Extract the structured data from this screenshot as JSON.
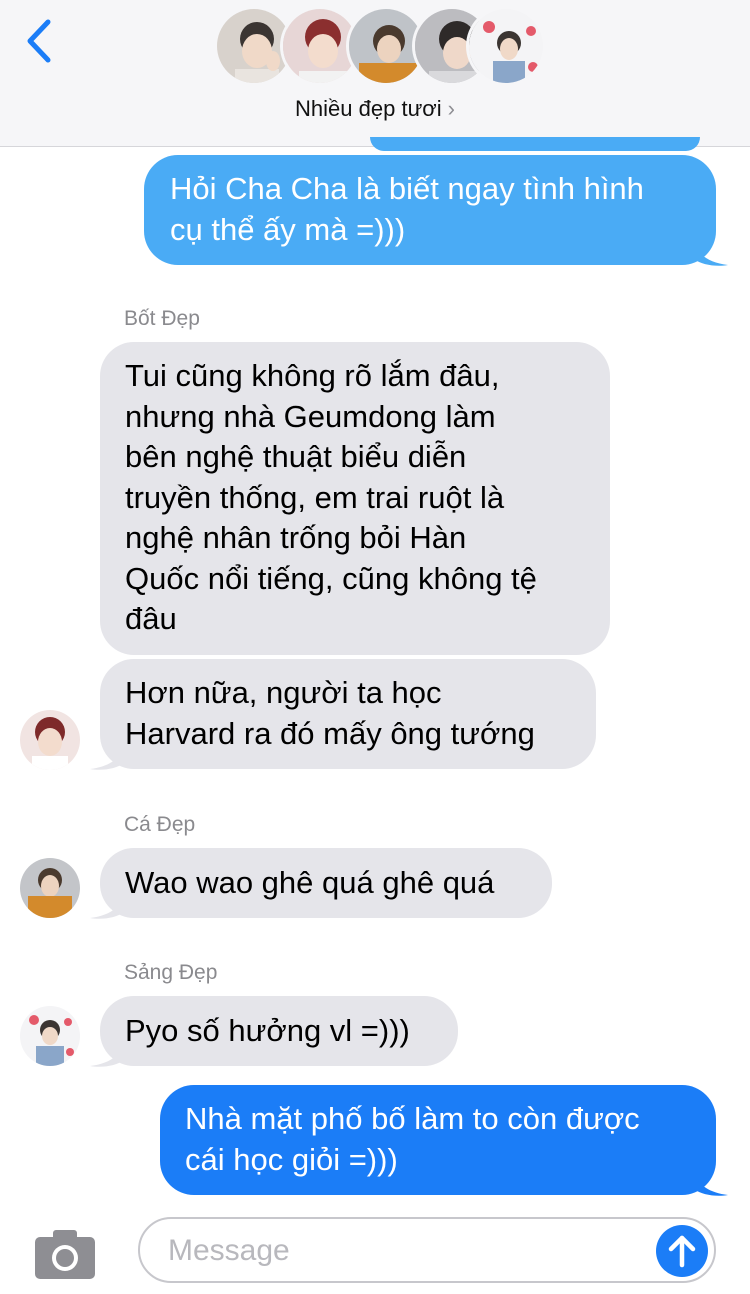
{
  "header": {
    "back_icon": "chevron-left-icon",
    "group_name": "Nhiều đẹp tươi",
    "group_chevron": "›",
    "accent": "#1b7df7"
  },
  "messages": [
    {
      "kind": "outgoing",
      "text_lines": [
        "Hỏi Cha Cha là biết ngay tình hình",
        "cụ thể ấy mà =)))"
      ]
    },
    {
      "kind": "incoming",
      "sender": "Bốt Đẹp",
      "text_lines": [
        "Tui cũng không rõ lắm đâu,",
        "nhưng nhà Geumdong làm",
        "bên nghệ thuật biểu diễn",
        "truyền thống, em trai ruột là",
        "nghệ nhân trống bỏi Hàn",
        "Quốc nổi tiếng, cũng không tệ",
        "đâu"
      ]
    },
    {
      "kind": "incoming",
      "text_lines": [
        "Hơn nữa, người ta học",
        "Harvard ra đó mấy ông tướng"
      ]
    },
    {
      "kind": "incoming",
      "sender": "Cá Đẹp",
      "text_lines": [
        "Wao wao ghê quá ghê quá"
      ]
    },
    {
      "kind": "incoming",
      "sender": "Sảng Đẹp",
      "text_lines": [
        "Pyo số hưởng vl =)))"
      ]
    },
    {
      "kind": "outgoing",
      "text_lines": [
        "Nhà mặt phố bố làm to còn được",
        "cái học giỏi =)))"
      ]
    }
  ],
  "composer": {
    "placeholder": "Message",
    "camera_icon": "camera-icon",
    "send_icon": "arrow-up-icon"
  }
}
